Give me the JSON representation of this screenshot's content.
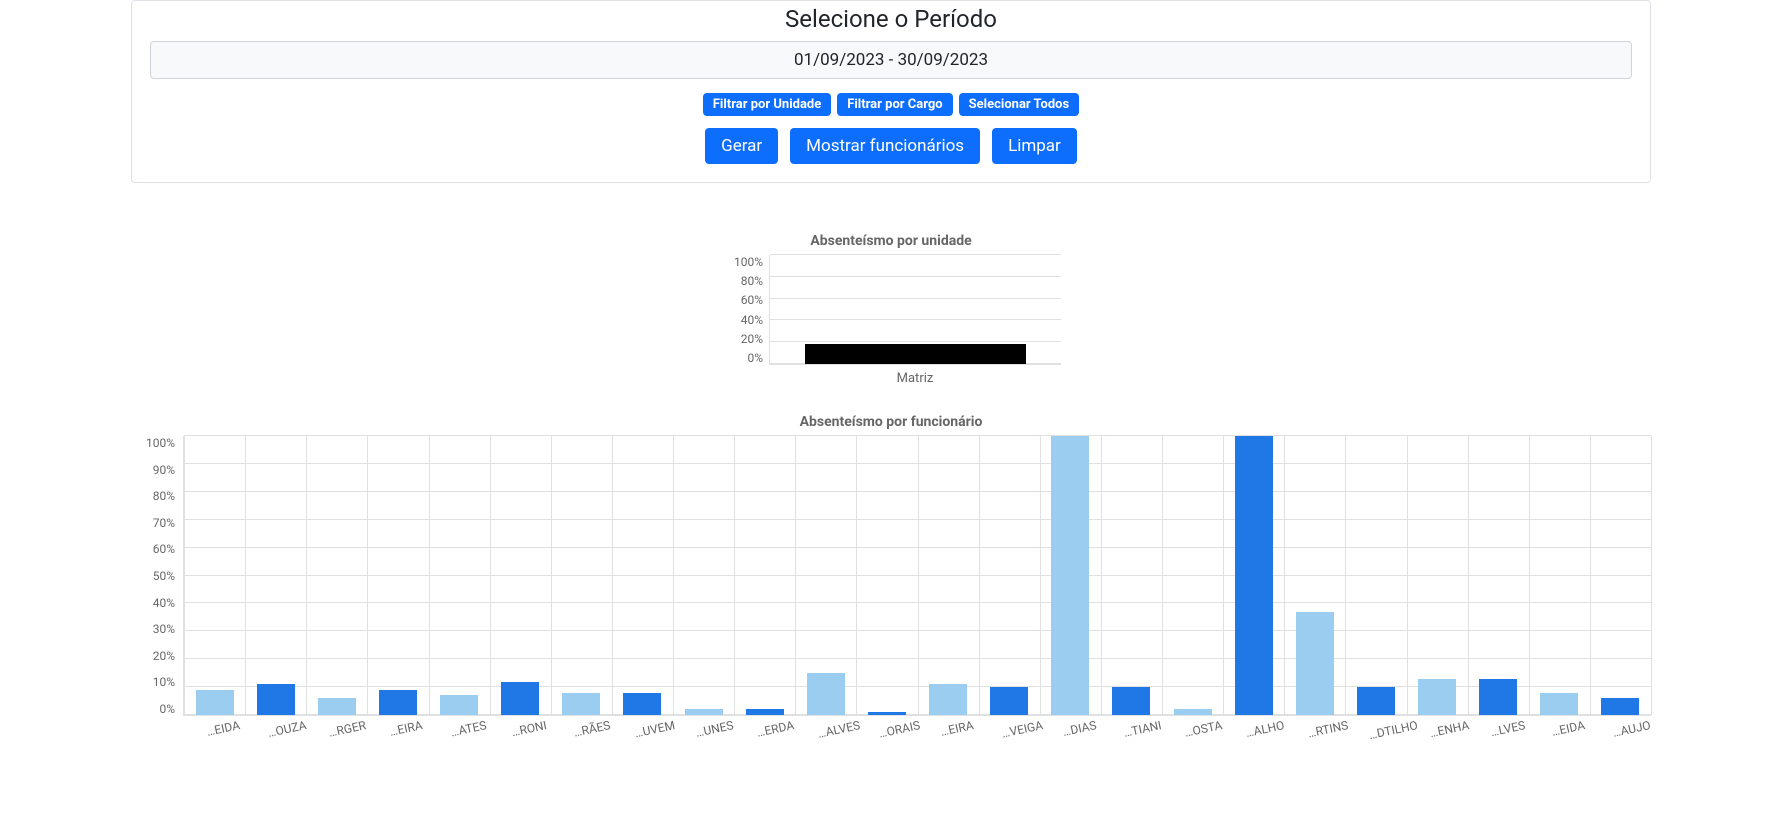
{
  "header": {
    "title": "Selecione o Período",
    "date_range": "01/09/2023 - 30/09/2023"
  },
  "buttons": {
    "filter_unit": "Filtrar por Unidade",
    "filter_role": "Filtrar por Cargo",
    "select_all": "Selecionar Todos",
    "generate": "Gerar",
    "show_employees": "Mostrar funcionários",
    "clear": "Limpar"
  },
  "colors": {
    "primary": "#0d6efd",
    "bar_light": "#9bcdf1",
    "bar_dark": "#1f78e5",
    "unit_bar": "#000000"
  },
  "chart_data": [
    {
      "id": "unit",
      "type": "bar",
      "title": "Absenteísmo por unidade",
      "categories": [
        "Matriz"
      ],
      "values": [
        18
      ],
      "ylim": [
        0,
        100
      ],
      "y_ticks": [
        "100%",
        "80%",
        "60%",
        "40%",
        "20%",
        "0%"
      ],
      "xlabel": "",
      "ylabel": ""
    },
    {
      "id": "employee",
      "type": "bar",
      "title": "Absenteísmo por funcionário",
      "categories": [
        "…EIDA",
        "…OUZA",
        "…RGER",
        "…EIRA",
        "…ATES",
        "…RONI",
        "…RÃES",
        "…UVEM",
        "…UNES",
        "…ERDA",
        "…ALVES",
        "…ORAIS",
        "…EIRA",
        "…VEIGA",
        "…DIAS",
        "…TIANI",
        "…OSTA",
        "…ALHO",
        "…RTINS",
        "…DTILHO",
        "…ENHA",
        "…LVES",
        "…EIDA",
        "…AUJO"
      ],
      "values": [
        9,
        11,
        6,
        9,
        7,
        12,
        8,
        8,
        2,
        2,
        15,
        1,
        11,
        10,
        100,
        10,
        2,
        100,
        37,
        10,
        13,
        13,
        8,
        6
      ],
      "ylim": [
        0,
        100
      ],
      "y_ticks": [
        "100%",
        "90%",
        "80%",
        "70%",
        "60%",
        "50%",
        "40%",
        "30%",
        "20%",
        "10%",
        "0%"
      ],
      "xlabel": "",
      "ylabel": ""
    }
  ]
}
